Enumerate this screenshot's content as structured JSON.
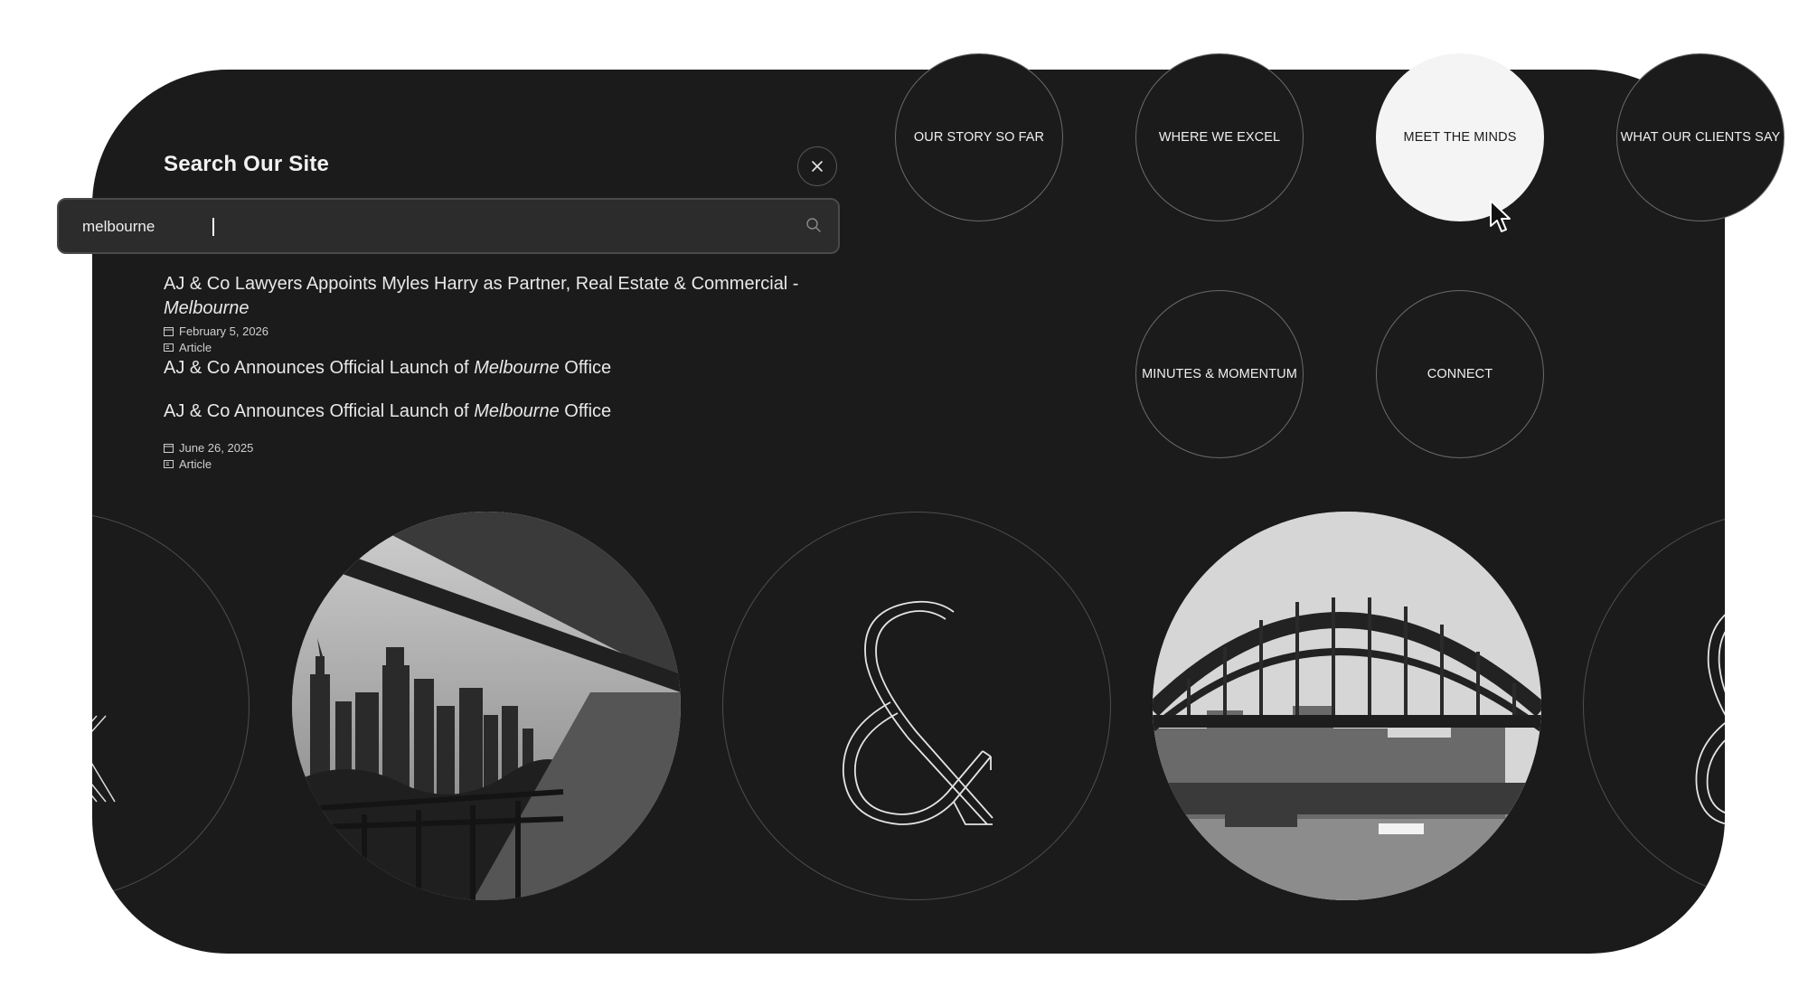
{
  "search": {
    "title": "Search Our Site",
    "query": "melbourne",
    "close_icon": "close-icon",
    "search_icon": "search-icon"
  },
  "results": [
    {
      "title_before": "AJ & Co Lawyers Appoints Myles Harry as Partner, Real Estate & Commercial -",
      "title_highlight": "Melbourne",
      "title_after": "",
      "date": "February 5, 2026",
      "type": "Article"
    },
    {
      "title_before": "AJ & Co Announces Official Launch of",
      "title_highlight": "Melbourne",
      "title_after": "Office"
    },
    {
      "title_before": "AJ & Co Announces Official Launch of",
      "title_highlight": "Melbourne",
      "title_after": "Office",
      "date": "June 26, 2025",
      "type": "Article"
    }
  ],
  "nav": [
    {
      "label": "OUR STORY SO FAR"
    },
    {
      "label": "WHERE WE EXCEL"
    },
    {
      "label": "MEET THE MINDS",
      "active": true
    },
    {
      "label": "WHAT OUR CLIENTS SAY"
    },
    {
      "label": "MINUTES & MOMENTUM"
    },
    {
      "label": "CONNECT"
    }
  ],
  "carousel": [
    {
      "image": "ampersand-logo-partial"
    },
    {
      "image": "melbourne-skyline-photo"
    },
    {
      "image": "ampersand-logo"
    },
    {
      "image": "sydney-harbour-bridge-photo"
    },
    {
      "image": "ampersand-logo-partial"
    }
  ],
  "colors": {
    "panel": "#1b1b1b",
    "active_nav": "#f4f4f4",
    "text": "#eaeaea"
  }
}
